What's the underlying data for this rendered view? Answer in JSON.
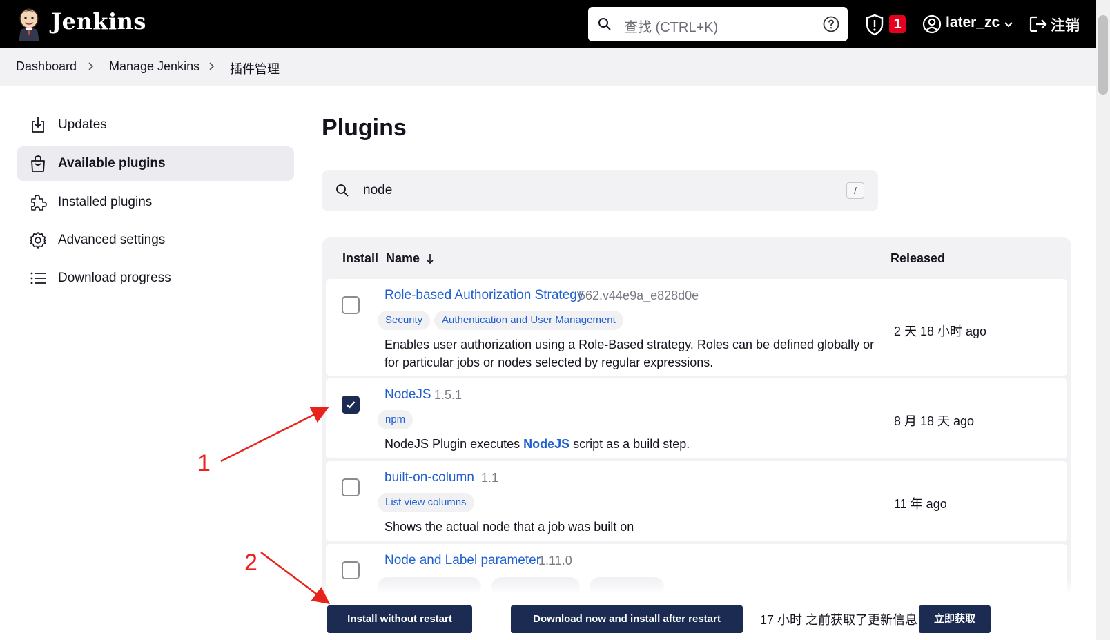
{
  "header": {
    "brand": "Jenkins",
    "search_placeholder": "查找 (CTRL+K)",
    "security_count": "1",
    "user_name": "later_zc",
    "logout_label": "注销"
  },
  "breadcrumb": [
    "Dashboard",
    "Manage Jenkins",
    "插件管理"
  ],
  "sidebar": {
    "items": [
      {
        "label": "Updates",
        "icon": "download-icon"
      },
      {
        "label": "Available plugins",
        "icon": "shopping-bag-icon",
        "active": true
      },
      {
        "label": "Installed plugins",
        "icon": "puzzle-icon"
      },
      {
        "label": "Advanced settings",
        "icon": "gear-icon"
      },
      {
        "label": "Download progress",
        "icon": "list-icon"
      }
    ]
  },
  "main": {
    "title": "Plugins",
    "search_value": "node",
    "search_shortcut": "/"
  },
  "table": {
    "headers": {
      "install": "Install",
      "name": "Name",
      "released": "Released"
    },
    "rows": [
      {
        "name": "Role-based Authorization Strategy",
        "version": "562.v44e9a_e828d0e",
        "tags": [
          "Security",
          "Authentication and User Management"
        ],
        "description": "Enables user authorization using a Role-Based strategy. Roles can be defined globally or for particular jobs or nodes selected by regular expressions.",
        "released": "2 天 18 小时 ago",
        "checked": false
      },
      {
        "name": "NodeJS",
        "version": "1.5.1",
        "tags": [
          "npm"
        ],
        "description_pre": "NodeJS Plugin executes ",
        "description_bold": "NodeJS",
        "description_post": " script as a build step.",
        "released": "8 月 18 天 ago",
        "checked": true
      },
      {
        "name": "built-on-column",
        "version": "1.1",
        "tags": [
          "List view columns"
        ],
        "description": "Shows the actual node that a job was built on",
        "released": "11 年 ago",
        "checked": false
      },
      {
        "name": "Node and Label parameter",
        "version": "1.11.0",
        "tags": [],
        "description": "",
        "released": "",
        "checked": false
      }
    ]
  },
  "bottom": {
    "install_now": "Install without restart",
    "install_later": "Download now and install after restart",
    "update_info": "17 小时 之前获取了更新信息",
    "fetch_now": "立即获取"
  },
  "annotations": {
    "label_1": "1",
    "label_2": "2",
    "color": "#e8231b"
  },
  "colors": {
    "header_bg": "#000000",
    "accent": "#1b2b52",
    "link": "#1f5fd0",
    "badge": "#e6001f"
  }
}
